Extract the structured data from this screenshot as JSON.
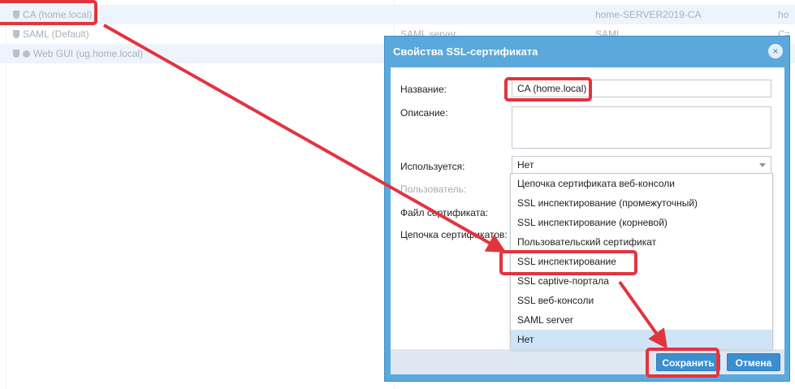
{
  "background_list": {
    "rows": [
      {
        "name": "CA (home.local)",
        "col2": "",
        "col3": "home-SERVER2019-CA",
        "col4": "ho"
      },
      {
        "name": "SAML (Default)",
        "col2": "SAML server",
        "col3": "SAML",
        "col4": "C="
      },
      {
        "name": "Web GUI (ug.home.local)",
        "col2": "",
        "col3": "",
        "col4": ""
      }
    ]
  },
  "dialog": {
    "title": "Свойства SSL-сертификата",
    "close_icon": "×",
    "labels": {
      "name": "Название:",
      "description": "Описание:",
      "used_for": "Используется:",
      "user": "Пользователь:",
      "cert_file": "Файл сертификата:",
      "cert_chain": "Цепочка сертификатов:"
    },
    "fields": {
      "name_value": "CA (home.local)",
      "description_value": "",
      "used_for_value": "Нет"
    },
    "dropdown_options": [
      "Цепочка сертификата веб-консоли",
      "SSL инспектирование (промежуточный)",
      "SSL инспектирование (корневой)",
      "Пользовательский сертификат",
      "SSL инспектирование",
      "SSL captive-портала",
      "SSL веб-консоли",
      "SAML server",
      "Нет"
    ],
    "selected_option": "Нет",
    "buttons": {
      "save": "Сохранить",
      "cancel": "Отмена"
    }
  },
  "colors": {
    "dialog_header": "#5aa8dc",
    "button": "#3b8ed0",
    "highlight": "#e2343f",
    "selected_option": "#cfe4f6"
  }
}
